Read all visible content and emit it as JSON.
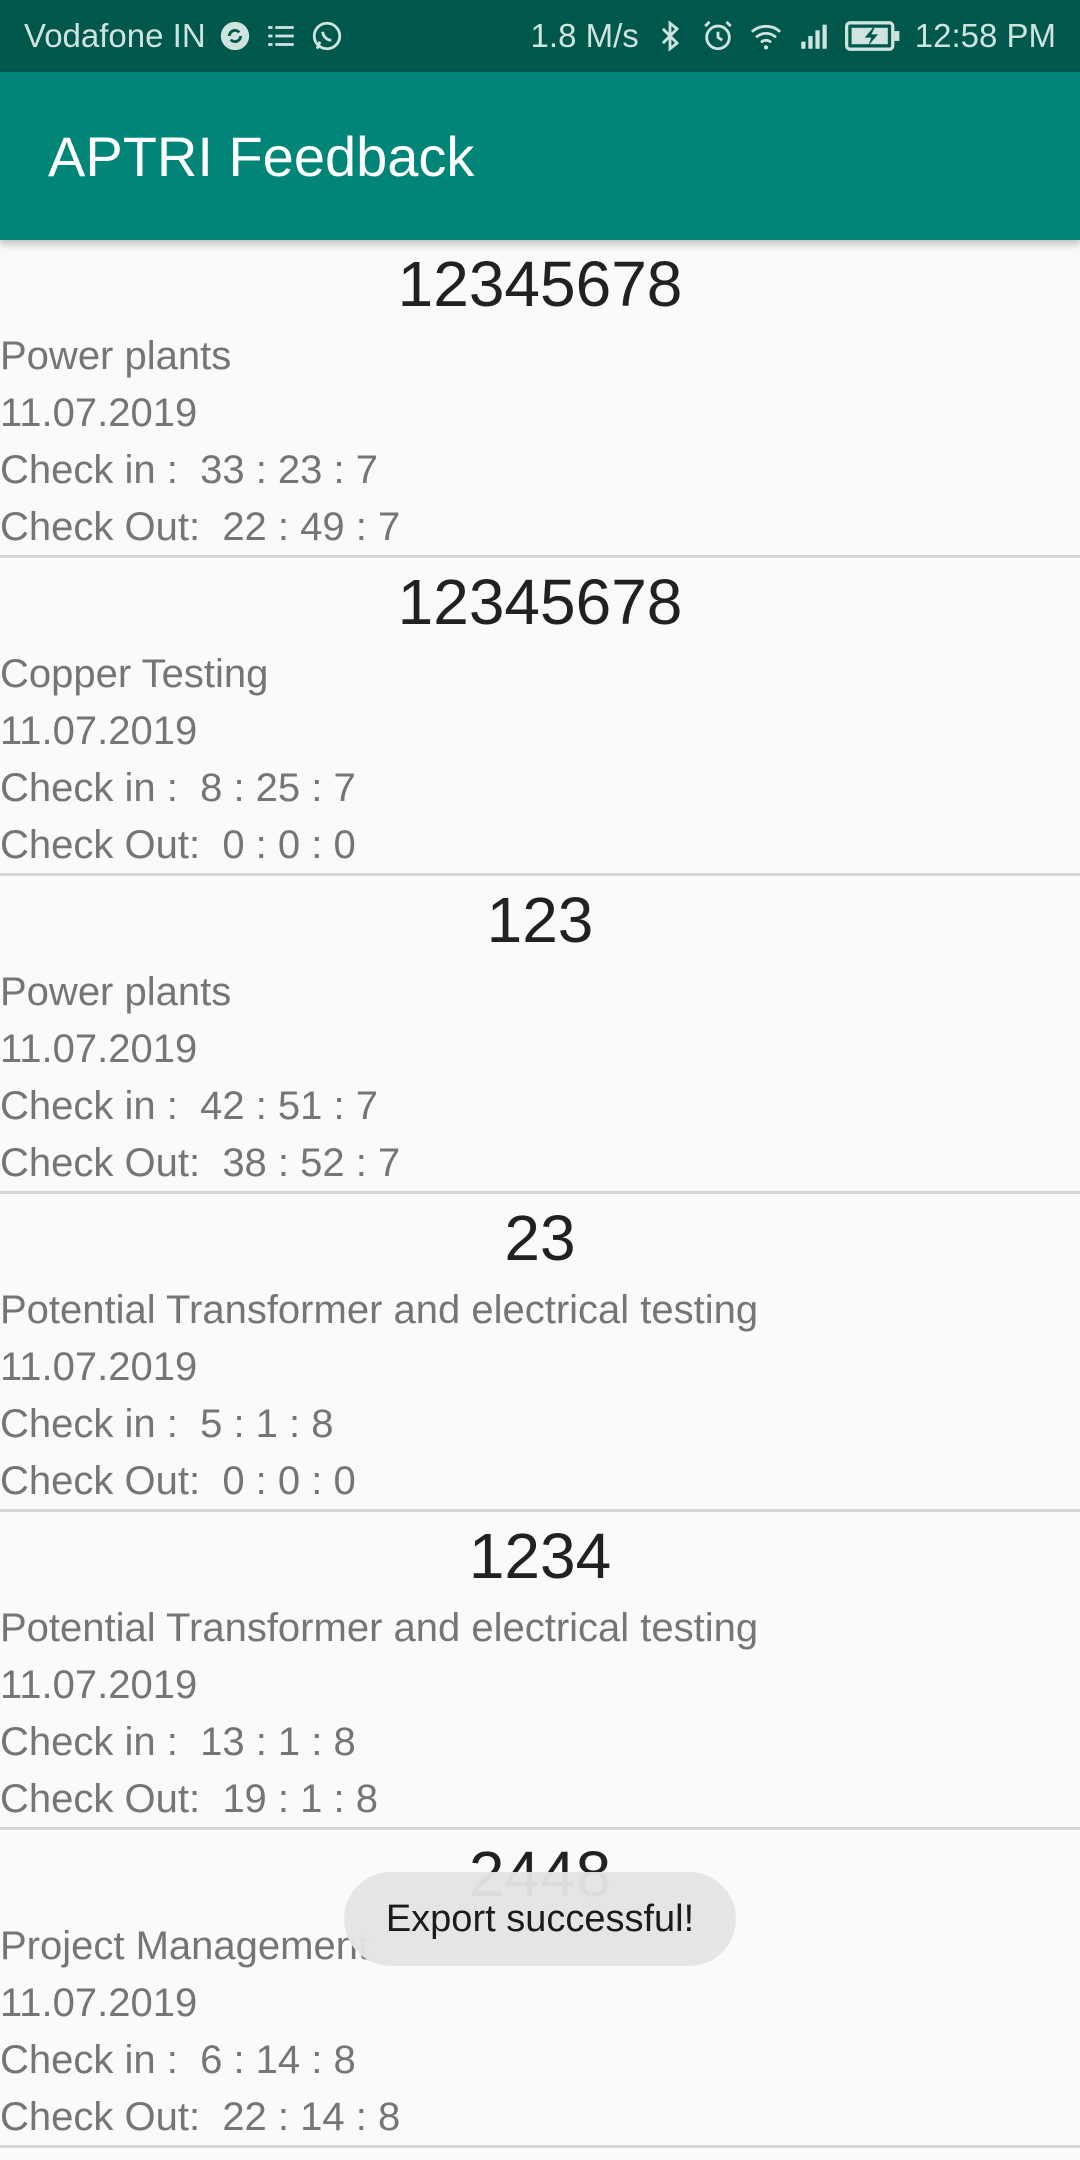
{
  "status_bar": {
    "carrier": "Vodafone IN",
    "speed": "1.8 M/s",
    "time": "12:58 PM",
    "icons": [
      "sync-icon",
      "list-icon",
      "whatsapp-icon",
      "bluetooth-icon",
      "alarm-icon",
      "wifi-icon",
      "signal-icon",
      "battery-charging-icon"
    ]
  },
  "app_bar": {
    "title": "APTRI Feedback"
  },
  "entries": [
    {
      "id": "12345678",
      "category": "Power plants",
      "date": "11.07.2019",
      "check_in_label": "Check in :",
      "check_in": "33 : 23 : 7",
      "check_out_label": "Check Out:",
      "check_out": "22 : 49 : 7"
    },
    {
      "id": "12345678",
      "category": "Copper Testing",
      "date": "11.07.2019",
      "check_in_label": "Check in :",
      "check_in": "8 : 25 : 7",
      "check_out_label": "Check Out:",
      "check_out": "0 : 0 : 0"
    },
    {
      "id": "123",
      "category": "Power plants",
      "date": "11.07.2019",
      "check_in_label": "Check in :",
      "check_in": "42 : 51 : 7",
      "check_out_label": "Check Out:",
      "check_out": "38 : 52 : 7"
    },
    {
      "id": "23",
      "category": "Potential Transformer and electrical testing",
      "date": "11.07.2019",
      "check_in_label": "Check in :",
      "check_in": "5 : 1 : 8",
      "check_out_label": "Check Out:",
      "check_out": "0 : 0 : 0"
    },
    {
      "id": "1234",
      "category": "Potential Transformer and electrical testing",
      "date": "11.07.2019",
      "check_in_label": "Check in :",
      "check_in": "13 : 1 : 8",
      "check_out_label": "Check Out:",
      "check_out": "19 : 1 : 8"
    },
    {
      "id": "2448",
      "category": "Project Management",
      "date": "11.07.2019",
      "check_in_label": "Check in :",
      "check_in": "6 : 14 : 8",
      "check_out_label": "Check Out:",
      "check_out": "22 : 14 : 8"
    }
  ],
  "toast": {
    "message": "Export successful!"
  }
}
